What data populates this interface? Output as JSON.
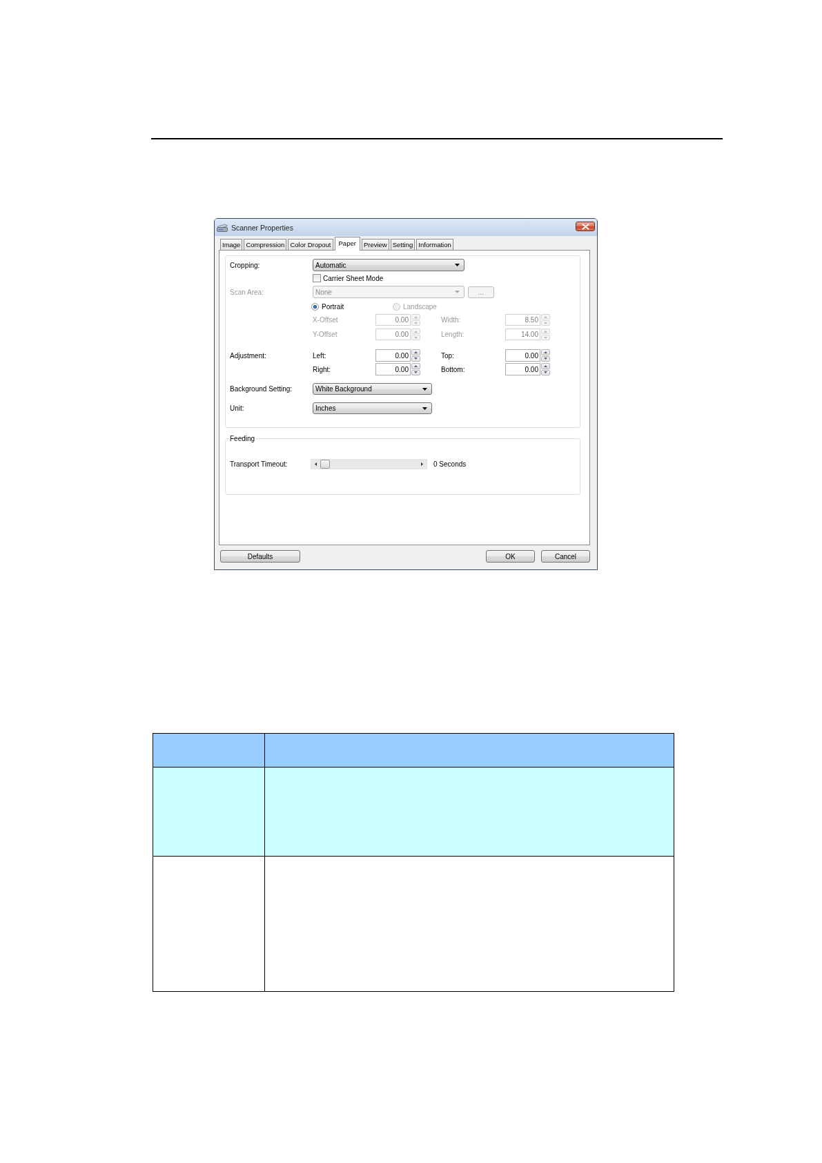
{
  "window": {
    "title": "Scanner Properties"
  },
  "tabs": [
    {
      "label": "Image",
      "selected": false
    },
    {
      "label": "Compression",
      "selected": false
    },
    {
      "label": "Color Dropout",
      "selected": false
    },
    {
      "label": "Paper",
      "selected": true
    },
    {
      "label": "Preview",
      "selected": false
    },
    {
      "label": "Setting",
      "selected": false
    },
    {
      "label": "Information",
      "selected": false
    }
  ],
  "paper": {
    "cropping": {
      "label": "Cropping:",
      "value": "Automatic"
    },
    "carrier_sheet_mode": {
      "label": "Carrier Sheet Mode",
      "checked": false
    },
    "scan_area": {
      "label": "Scan Area:",
      "value": "None",
      "button": "...",
      "disabled": true
    },
    "orientation": [
      {
        "label": "Portrait",
        "selected": true,
        "disabled": false
      },
      {
        "label": "Landscape",
        "selected": false,
        "disabled": true
      }
    ],
    "size_fields": [
      {
        "label": "X-Offset",
        "value": "0.00",
        "disabled": true
      },
      {
        "label": "Width:",
        "value": "8.50",
        "disabled": true
      },
      {
        "label": "Y-Offset",
        "value": "0.00",
        "disabled": true
      },
      {
        "label": "Length:",
        "value": "14.00",
        "disabled": true
      }
    ],
    "adjustment": {
      "label": "Adjustment:",
      "fields": [
        {
          "label": "Left:",
          "value": "0.00",
          "disabled": false
        },
        {
          "label": "Top:",
          "value": "0.00",
          "disabled": false
        },
        {
          "label": "Right:",
          "value": "0.00",
          "disabled": false
        },
        {
          "label": "Bottom:",
          "value": "0.00",
          "disabled": false
        }
      ]
    },
    "background_setting": {
      "label": "Background Setting:",
      "value": "White Background"
    },
    "unit": {
      "label": "Unit:",
      "value": "Inches"
    }
  },
  "feeding": {
    "title": "Feeding",
    "transport_timeout": {
      "label": "Transport Timeout:",
      "level": 0,
      "reading": "0 Seconds"
    }
  },
  "buttons": [
    "Defaults",
    "OK",
    "Cancel"
  ],
  "table": {
    "rows": [
      {
        "kind": "header"
      },
      {
        "kind": "shaded"
      },
      {
        "kind": "plain"
      }
    ]
  }
}
